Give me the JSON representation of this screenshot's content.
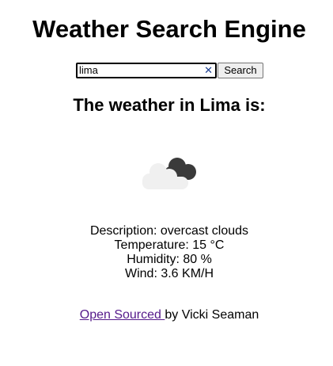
{
  "app": {
    "title": "Weather Search Engine"
  },
  "search": {
    "value": "lima",
    "clear_glyph": "✕",
    "button_label": "Search"
  },
  "result": {
    "heading": "The weather in Lima is:",
    "icon": "overcast-clouds-icon",
    "description": "Description: overcast clouds",
    "temperature": "Temperature: 15 °C",
    "humidity": "Humidity: 80 %",
    "wind": "Wind: 3.6 KM/H"
  },
  "footer": {
    "link_text": "Open Sourced ",
    "byline": "by Vicki Seaman"
  },
  "colors": {
    "link": "#551a8b",
    "cloud_front": "#f0f0f0",
    "cloud_back": "#3a3a3a",
    "clear_icon": "#1a3d8f"
  }
}
